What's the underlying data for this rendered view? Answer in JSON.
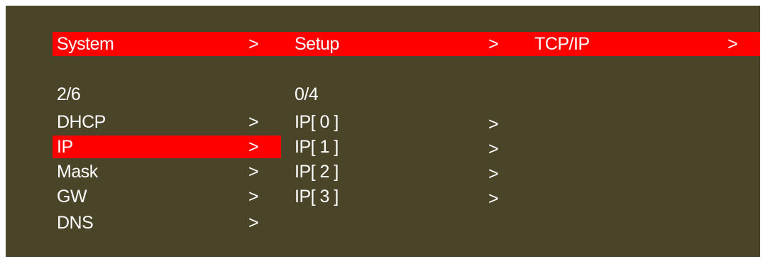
{
  "colors": {
    "background": "#4a4428",
    "highlight": "#ff0000",
    "text": "#ffffff"
  },
  "breadcrumb": {
    "items": [
      {
        "label": "System",
        "arrow": ">"
      },
      {
        "label": "Setup",
        "arrow": ">"
      },
      {
        "label": "TCP/IP",
        "arrow": ">"
      }
    ]
  },
  "left_menu": {
    "counter": "2/6",
    "selected_index": 1,
    "items": [
      {
        "label": "DHCP",
        "arrow": ">"
      },
      {
        "label": "IP",
        "arrow": ">"
      },
      {
        "label": "Mask",
        "arrow": ">"
      },
      {
        "label": "GW",
        "arrow": ">"
      },
      {
        "label": "DNS",
        "arrow": ">"
      }
    ]
  },
  "right_menu": {
    "counter": "0/4",
    "items": [
      {
        "label": "IP[ 0 ]",
        "arrow": ">"
      },
      {
        "label": "IP[ 1 ]",
        "arrow": ">"
      },
      {
        "label": "IP[ 2 ]",
        "arrow": ">"
      },
      {
        "label": "IP[ 3 ]",
        "arrow": ">"
      }
    ]
  }
}
